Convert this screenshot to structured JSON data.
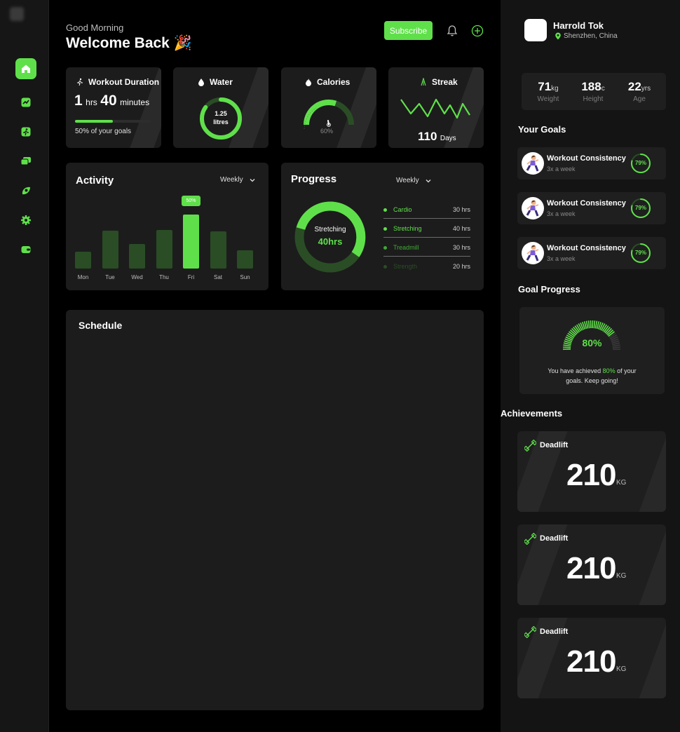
{
  "header": {
    "greeting": "Good Morning",
    "welcome": "Welcome Back 🎉",
    "subscribe_label": "Subscribe"
  },
  "stats": {
    "workout": {
      "title": "Workout Duration",
      "hours": "1",
      "hrs_unit": "hrs",
      "minutes": "40",
      "min_unit": "minutes",
      "goal_text": "50% of your goals",
      "progress": 0.5
    },
    "water": {
      "title": "Water",
      "amount": "1.25",
      "unit": "litres",
      "fill": 0.85
    },
    "calories": {
      "title": "Calories",
      "percent": "60%",
      "fill": 0.6
    },
    "streak": {
      "title": "Streak",
      "value": "110",
      "unit": "Days"
    }
  },
  "activity": {
    "title": "Activity",
    "period": "Weekly",
    "highlight_label": "50%",
    "highlight_index": 4,
    "chart_data": {
      "type": "bar",
      "categories": [
        "Mon",
        "Tue",
        "Wed",
        "Thu",
        "Fri",
        "Sat",
        "Sun"
      ],
      "values": [
        24,
        54,
        35,
        55,
        77,
        53,
        26
      ]
    }
  },
  "progress": {
    "title": "Progress",
    "period": "Weekly",
    "center_label": "Stretching",
    "center_value": "40hrs",
    "items": [
      {
        "label": "Cardio",
        "value": "30 hrs"
      },
      {
        "label": "Stretching",
        "value": "40 hrs"
      },
      {
        "label": "Treadmill",
        "value": "30 hrs"
      },
      {
        "label": "Strength",
        "value": "20 hrs"
      }
    ]
  },
  "schedule": {
    "title": "Schedule"
  },
  "profile": {
    "name": "Harrold Tok",
    "location": "Shenzhen, China",
    "metrics": [
      {
        "value": "71",
        "unit": "kg",
        "label": "Weight"
      },
      {
        "value": "188",
        "unit": "c",
        "label": "Height"
      },
      {
        "value": "22",
        "unit": "yrs",
        "label": "Age"
      }
    ]
  },
  "goals": {
    "title": "Your Goals",
    "items": [
      {
        "title": "Workout Consistency",
        "sub": "3x a week",
        "percent": "79%",
        "fill": 0.79
      },
      {
        "title": "Workout Consistency",
        "sub": "3x a week",
        "percent": "79%",
        "fill": 0.79
      },
      {
        "title": "Workout Consistency",
        "sub": "3x a week",
        "percent": "79%",
        "fill": 0.79
      }
    ]
  },
  "goal_progress": {
    "title": "Goal Progress",
    "percent": "80%",
    "fill": 0.8,
    "text_before": "You have achieved ",
    "text_highlight": "80%",
    "text_after": " of your",
    "text_line2": "goals. Keep going!"
  },
  "achievements": {
    "title": "Achievements",
    "items": [
      {
        "title": "Deadlift",
        "value": "210",
        "unit": "KG"
      },
      {
        "title": "Deadlift",
        "value": "210",
        "unit": "KG"
      },
      {
        "title": "Deadlift",
        "value": "210",
        "unit": "KG"
      }
    ]
  },
  "colors": {
    "accent": "#5fe04a",
    "dim_green": "#2a4d25",
    "panel": "#1c1c1c"
  }
}
